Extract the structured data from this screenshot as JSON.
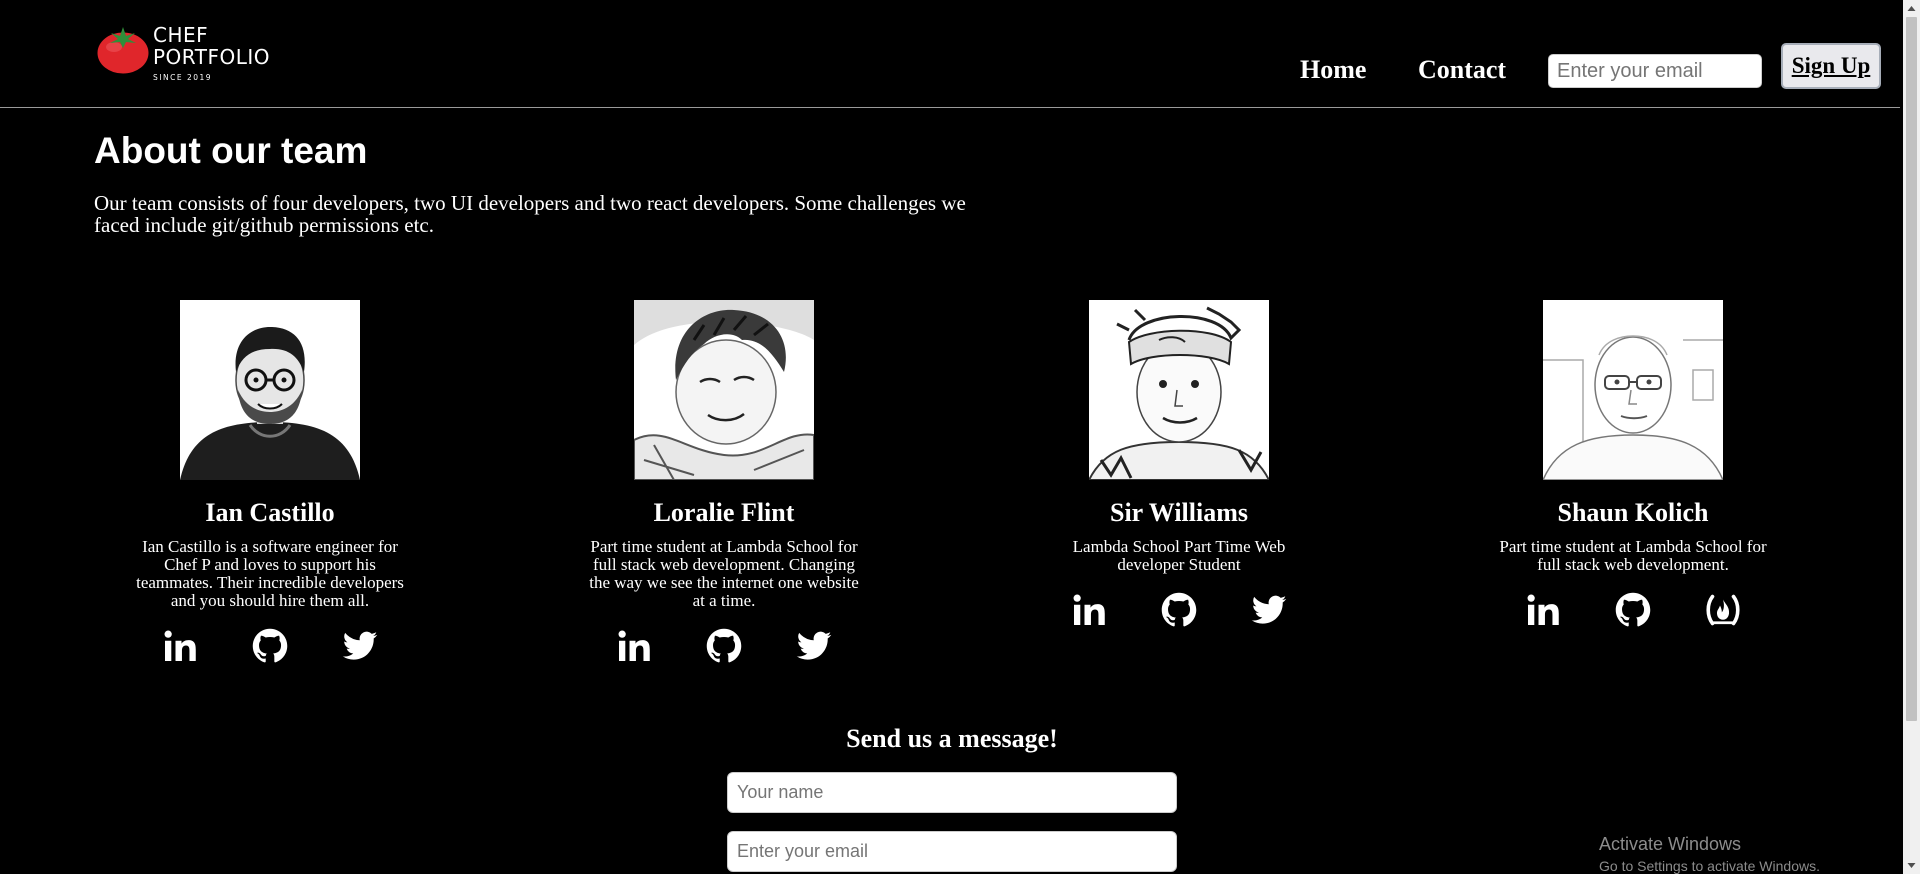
{
  "header": {
    "logo": {
      "line1": "CHEF",
      "line2": "PORTFOLIO",
      "since": "SINCE 2019"
    },
    "nav": {
      "home": "Home",
      "contact": "Contact"
    },
    "email_placeholder": "Enter your email",
    "signup_label": "Sign Up"
  },
  "about": {
    "title": "About our team",
    "text": "Our team consists of four developers, two UI developers and two react developers. Some challenges we faced include git/github permissions etc."
  },
  "team": [
    {
      "name": "Ian Castillo",
      "bio": "Ian Castillo is a software engineer for Chef P and loves to support his teammates. Their incredible developers and you should hire them all.",
      "socials": [
        "linkedin-icon",
        "github-icon",
        "twitter-icon"
      ]
    },
    {
      "name": "Loralie Flint",
      "bio": "Part time student at Lambda School for full stack web development. Changing the way we see the internet one website at a time.",
      "socials": [
        "linkedin-icon",
        "github-icon",
        "twitter-icon"
      ]
    },
    {
      "name": "Sir Williams",
      "bio": "Lambda School Part Time Web developer Student",
      "socials": [
        "linkedin-icon",
        "github-icon",
        "twitter-icon"
      ]
    },
    {
      "name": "Shaun Kolich",
      "bio": "Part time student at Lambda School for full stack web development.",
      "socials": [
        "linkedin-icon",
        "github-icon",
        "freecodecamp-icon"
      ]
    }
  ],
  "contact": {
    "title": "Send us a message!",
    "name_placeholder": "Your name",
    "email_placeholder": "Enter your email"
  },
  "watermark": {
    "line1": "Activate Windows",
    "line2": "Go to Settings to activate Windows."
  },
  "colors": {
    "background": "#000000",
    "text": "#ffffff",
    "logo_tomato": "#e0262b",
    "divider": "#9a9a9a"
  }
}
